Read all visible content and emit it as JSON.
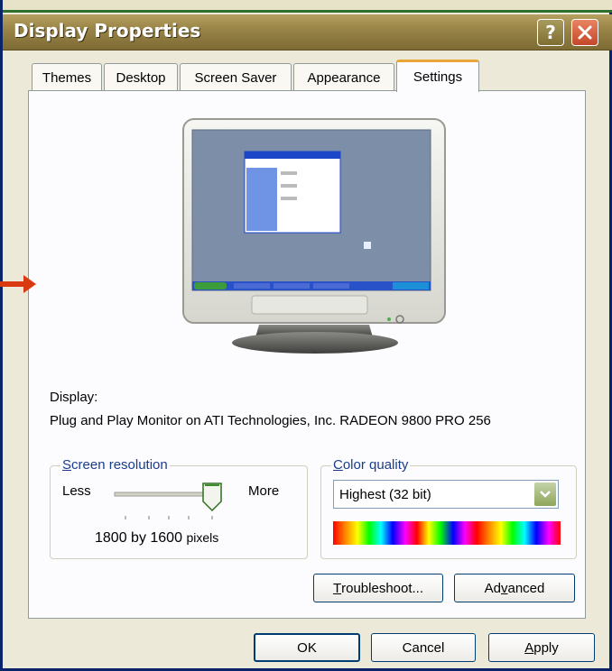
{
  "window": {
    "title": "Display Properties"
  },
  "titlebar": {
    "help_label": "?"
  },
  "tabs": [
    {
      "label": "Themes"
    },
    {
      "label": "Desktop"
    },
    {
      "label": "Screen Saver"
    },
    {
      "label": "Appearance"
    },
    {
      "label": "Settings"
    }
  ],
  "display": {
    "label": "Display:",
    "value": "Plug and Play Monitor on ATI Technologies, Inc. RADEON 9800 PRO 256"
  },
  "resolution": {
    "group_title": "Screen resolution",
    "less_label": "Less",
    "more_label": "More",
    "value_text": "1800 by 1600",
    "unit_text": "pixels",
    "slider_level": 1.0
  },
  "color_quality": {
    "group_title": "Color quality",
    "selected": "Highest (32 bit)",
    "spectrum_colors": [
      "#ff0000",
      "#ff8000",
      "#ffff00",
      "#00ff00",
      "#00ffff",
      "#0000ff",
      "#ff00ff",
      "#ff0000",
      "#ffff00",
      "#00ff00",
      "#0000ff",
      "#ff00ff",
      "#ff0000",
      "#ff8000",
      "#ffff00",
      "#00ff00",
      "#00ffff",
      "#0000ff",
      "#ff00ff"
    ]
  },
  "buttons": {
    "troubleshoot_prefix": "T",
    "troubleshoot_rest": "roubleshoot...",
    "advanced_a": "Ad",
    "advanced_v": "v",
    "advanced_rest": "anced",
    "ok": "OK",
    "cancel": "Cancel",
    "apply_a": "A",
    "apply_rest": "pply"
  },
  "colors": {
    "titlebar": "#9a8548",
    "dialog_bg": "#ece9d8",
    "group_title": "#1a3c8c",
    "arrow": "#d93a12"
  }
}
